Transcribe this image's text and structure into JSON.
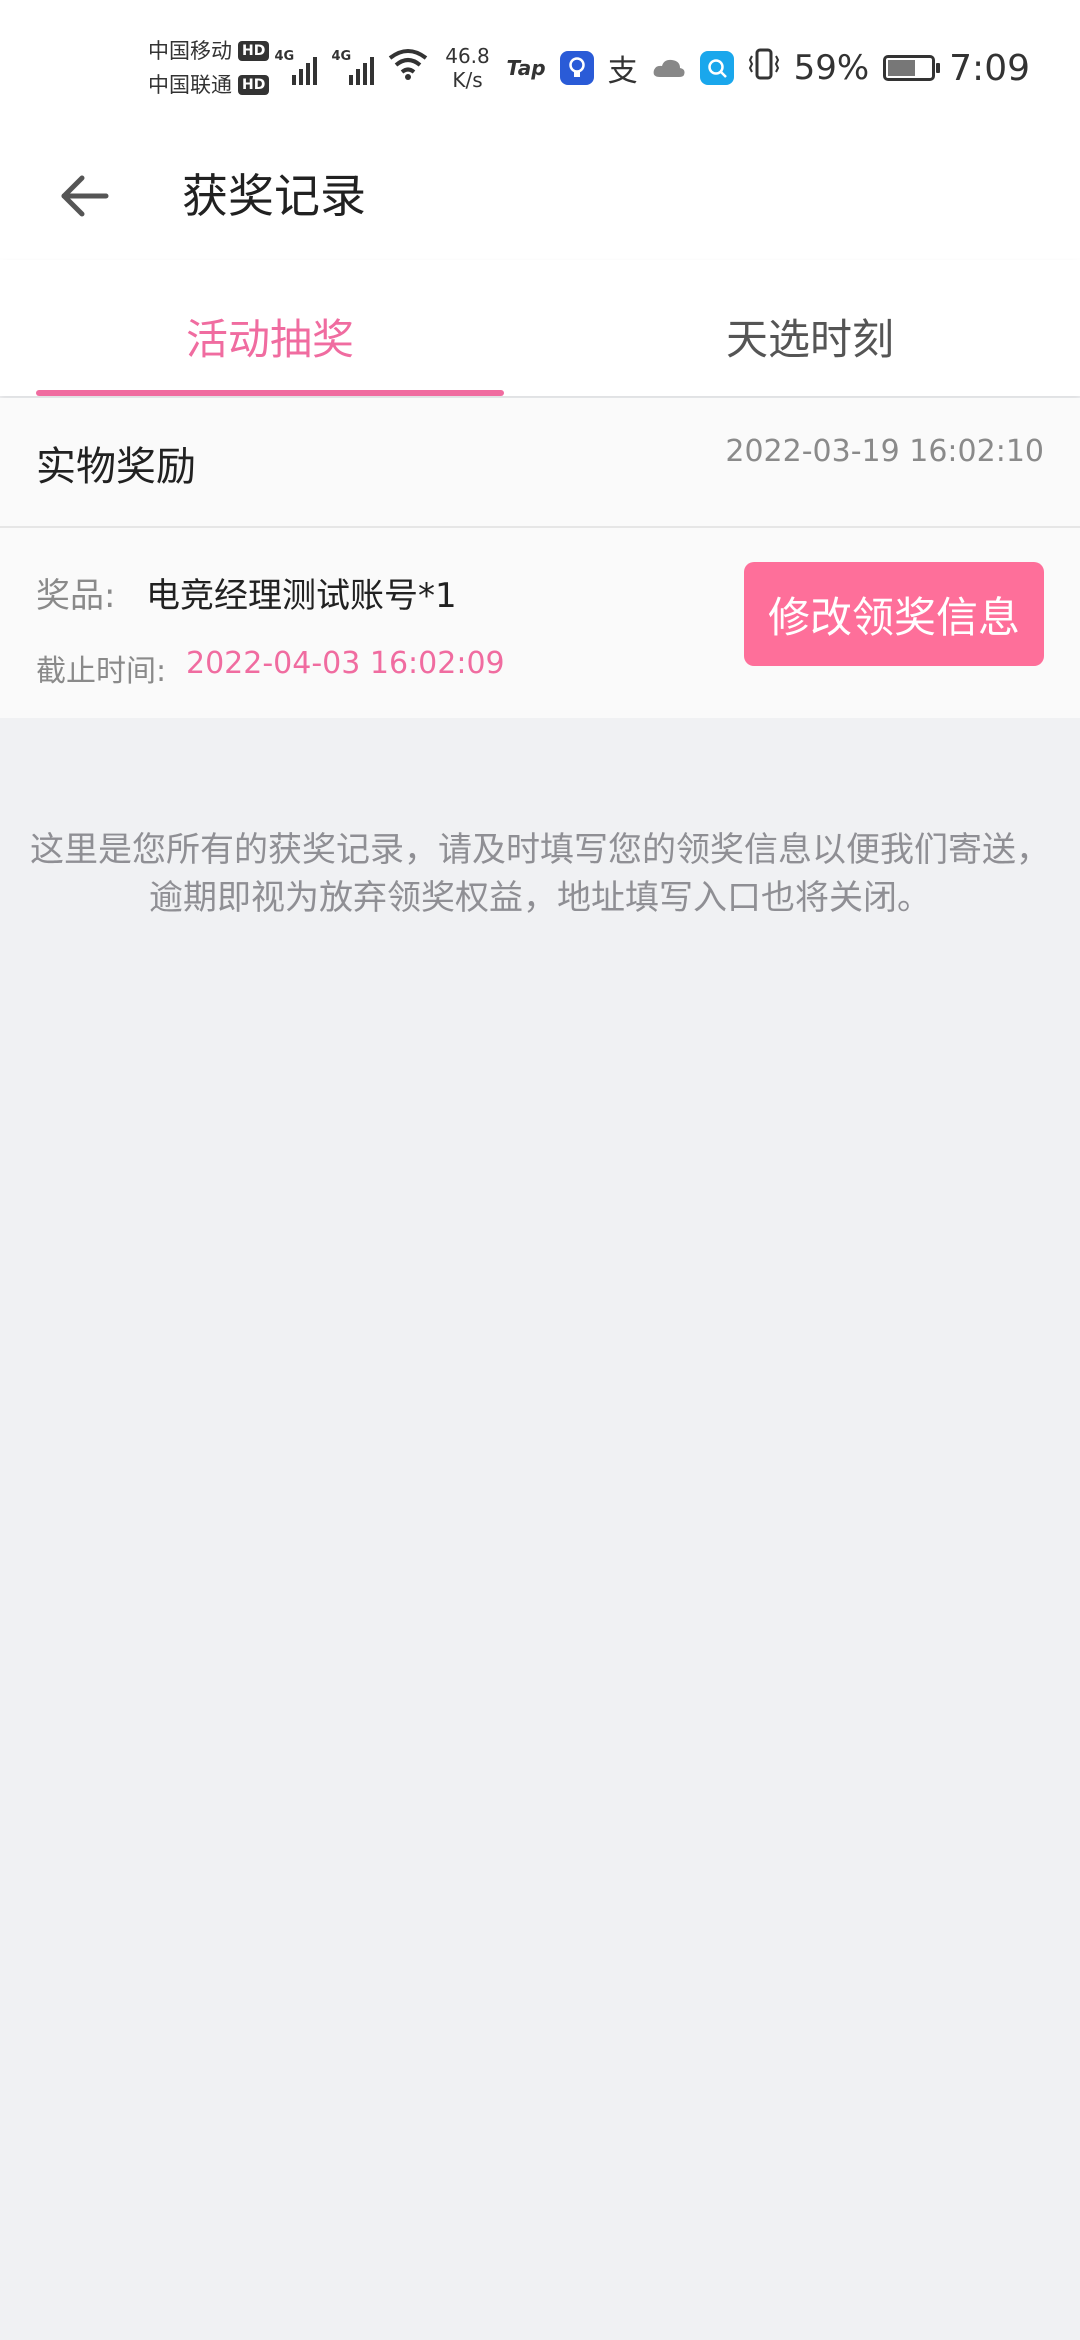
{
  "status_bar": {
    "carrier_1": "中国移动",
    "carrier_2": "中国联通",
    "hd": "HD",
    "network_1": "4G",
    "network_2": "4G",
    "speed_value": "46.8",
    "speed_unit": "K/s",
    "tap_label": "Tap",
    "battery_percent": "59%",
    "time": "7:09"
  },
  "nav": {
    "title": "获奖记录"
  },
  "tabs": [
    {
      "label": "活动抽奖",
      "active": true
    },
    {
      "label": "天选时刻",
      "active": false
    }
  ],
  "record": {
    "type": "实物奖励",
    "timestamp": "2022-03-19 16:02:10",
    "prize_label": "奖品:",
    "prize_value": "电竞经理测试账号*1",
    "deadline_label": "截止时间:",
    "deadline_value": "2022-04-03 16:02:09",
    "edit_button": "修改领奖信息"
  },
  "notice": {
    "line1": "这里是您所有的获奖记录，请及时填写您的领奖信息以便我们寄送，",
    "line2": "逾期即视为放弃领奖权益，地址填写入口也将关闭。"
  },
  "colors": {
    "accent": "#f06ca0",
    "button": "#fe6f9a",
    "background": "#f0f1f3"
  }
}
